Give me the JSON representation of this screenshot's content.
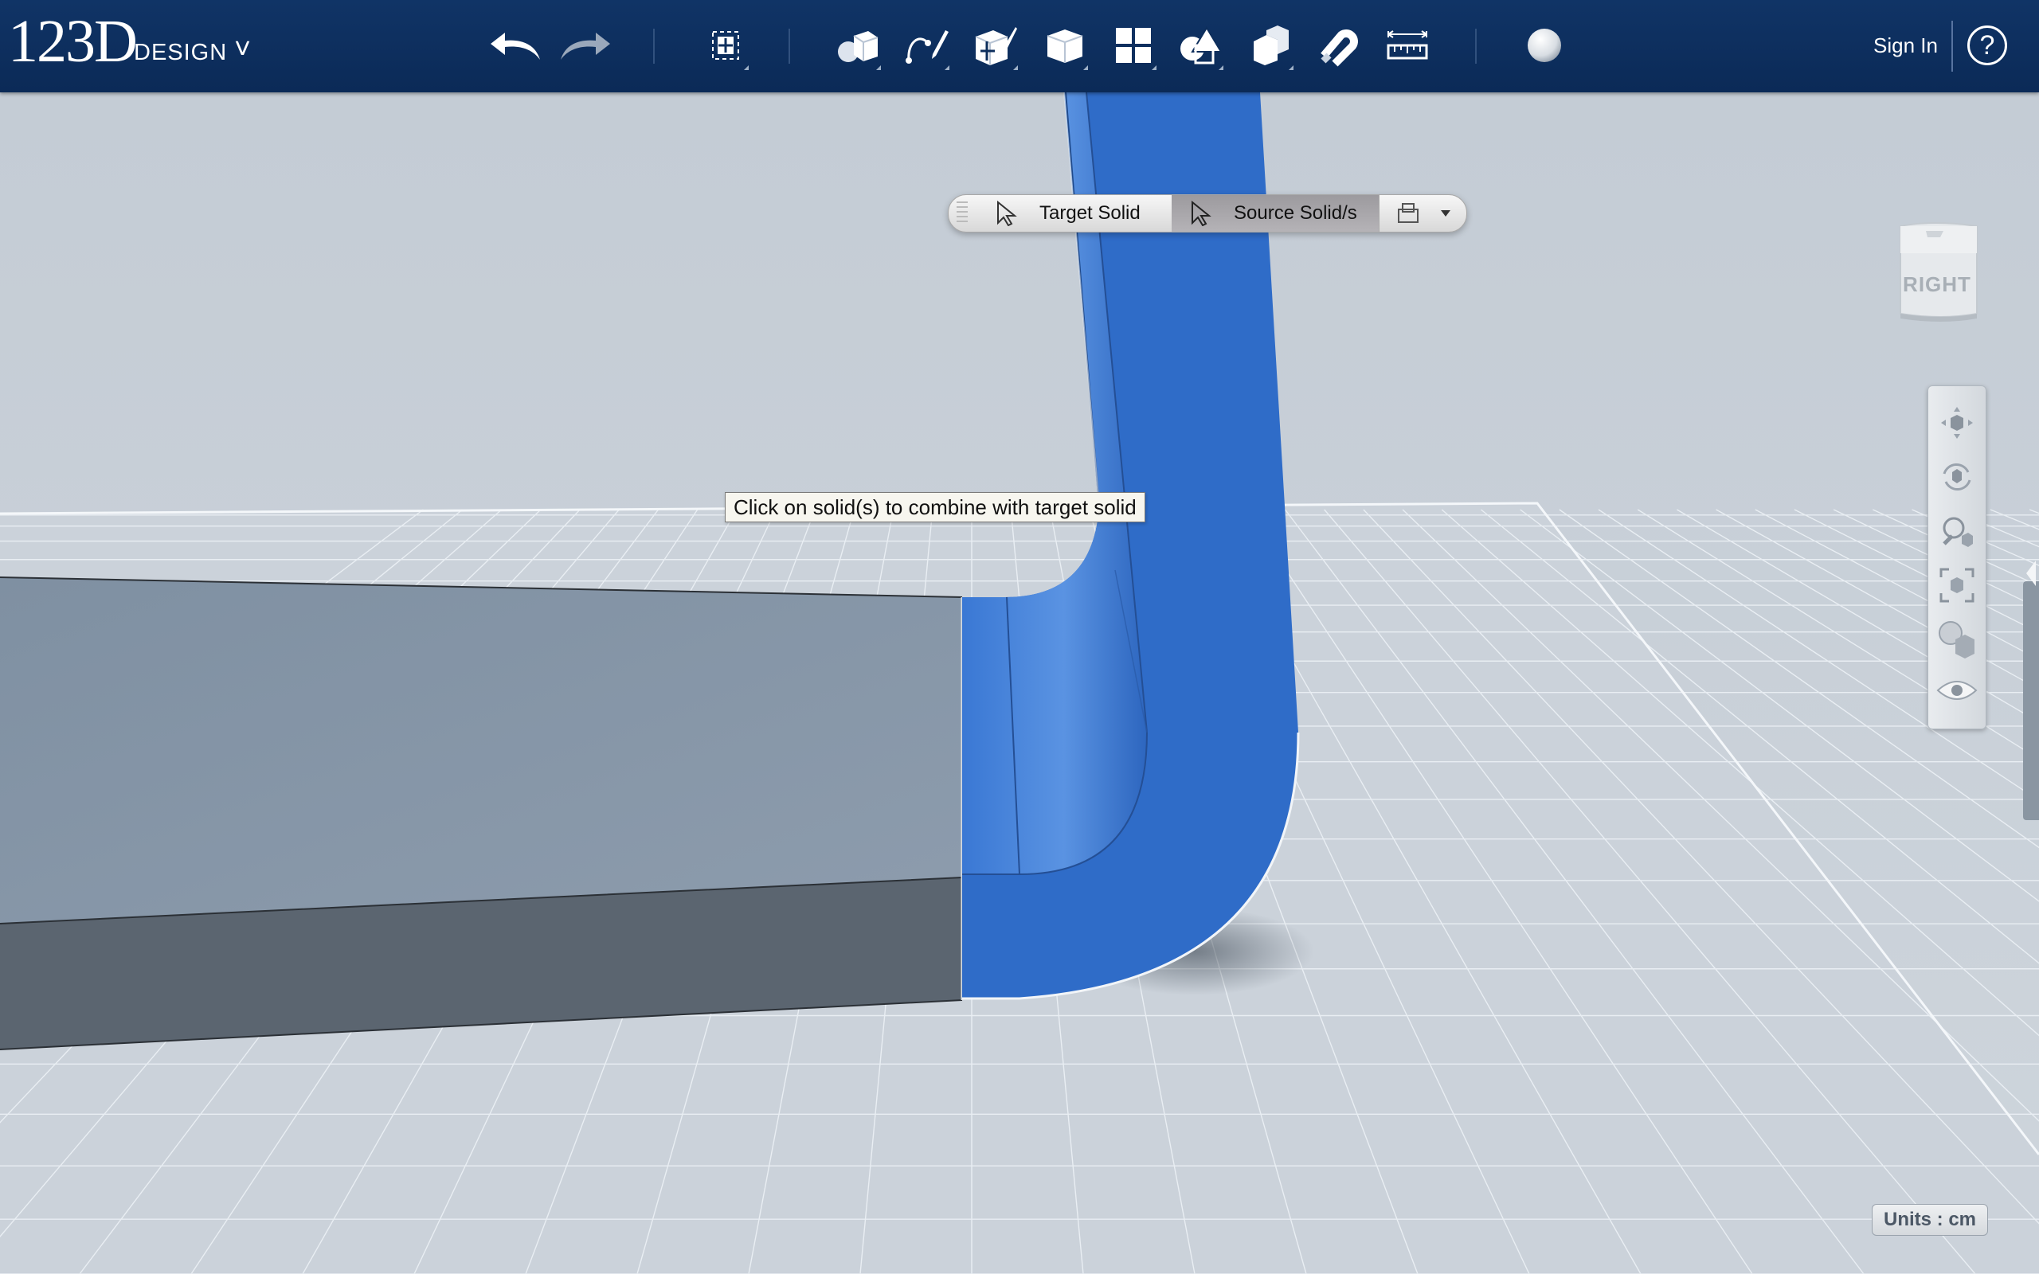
{
  "app": {
    "logo_main": "123D",
    "logo_sub": "DESIGN",
    "menu_chevron": "˅"
  },
  "toolbar": {
    "buttons": [
      {
        "name": "undo",
        "icon": "undo-arrow-icon"
      },
      {
        "name": "redo",
        "icon": "redo-arrow-icon"
      },
      {
        "name": "transform",
        "icon": "transform-icon"
      },
      {
        "name": "primitives",
        "icon": "primitives-icon"
      },
      {
        "name": "sketch",
        "icon": "sketch-icon"
      },
      {
        "name": "construct",
        "icon": "construct-icon"
      },
      {
        "name": "modify",
        "icon": "modify-icon"
      },
      {
        "name": "pattern",
        "icon": "pattern-icon"
      },
      {
        "name": "grouping",
        "icon": "grouping-icon"
      },
      {
        "name": "combine",
        "icon": "combine-icon"
      },
      {
        "name": "snap",
        "icon": "magnet-icon"
      },
      {
        "name": "measure",
        "icon": "ruler-icon"
      },
      {
        "name": "material",
        "icon": "material-sphere-icon"
      }
    ],
    "sign_in": "Sign In",
    "help": "?"
  },
  "combine_toolbar": {
    "target_label": "Target Solid",
    "source_label": "Source Solid/s",
    "active": "source",
    "mode_icon": "merge-mode-icon"
  },
  "hint": "Click on solid(s) to combine with target solid",
  "viewcube": {
    "face_label": "RIGHT"
  },
  "nav_tools": [
    "pan-icon",
    "orbit-icon",
    "zoom-icon",
    "fit-icon",
    "visual-style-icon",
    "visibility-eye-icon"
  ],
  "units": "Units : cm",
  "colors": {
    "topbar": "#0d2e5c",
    "solid_blue": "#2f6cc8",
    "grey_solid_top": "#8999aa",
    "grey_solid_side": "#5b6570",
    "grid_bg": "#c8d0d8"
  }
}
